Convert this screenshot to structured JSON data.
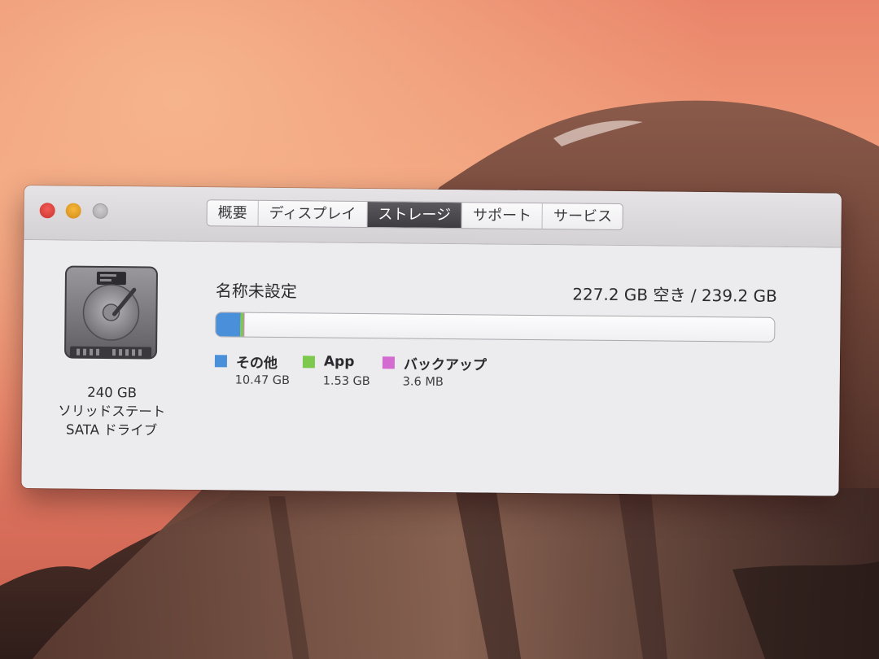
{
  "window": {
    "tabs": [
      {
        "label": "概要",
        "active": false
      },
      {
        "label": "ディスプレイ",
        "active": false
      },
      {
        "label": "ストレージ",
        "active": true
      },
      {
        "label": "サポート",
        "active": false
      },
      {
        "label": "サービス",
        "active": false
      }
    ]
  },
  "disk": {
    "capacity": "240 GB",
    "type": "ソリッドステート",
    "interface": "SATA ドライブ"
  },
  "storage": {
    "volume_name": "名称未設定",
    "free_summary": "227.2 GB 空き / 239.2 GB",
    "total_gb": 239.2,
    "segments": [
      {
        "label": "その他",
        "size": "10.47 GB",
        "gb": 10.47,
        "color": "#4a8fd9"
      },
      {
        "label": "App",
        "size": "1.53 GB",
        "gb": 1.53,
        "color": "#7cc94e"
      },
      {
        "label": "バックアップ",
        "size": "3.6 MB",
        "gb": 0.0036,
        "color": "#d36bd0"
      }
    ]
  },
  "colors": {
    "close": "#e0443e",
    "minimize": "#e9a227",
    "zoom": "#bcb9bd",
    "active_tab": "#4a484c"
  }
}
